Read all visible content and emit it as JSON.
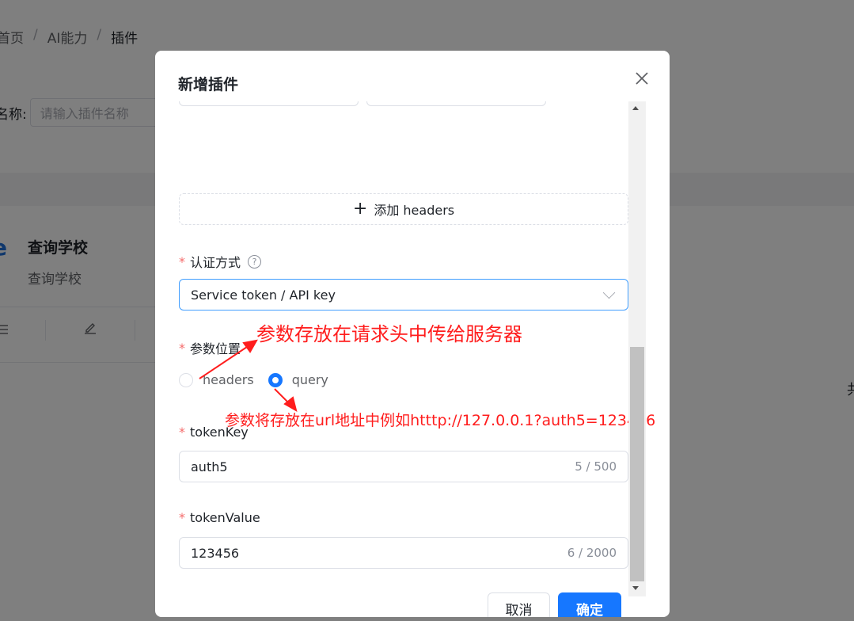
{
  "background": {
    "breadcrumb": [
      "首页",
      "AI能力",
      "插件"
    ],
    "breadcrumb_separator": "/",
    "filter_label": "名称:",
    "filter_placeholder": "请输入插件名称",
    "card_title": "查询学校",
    "card_desc": "查询学校",
    "card_logo": "e",
    "right_edge_text": "共"
  },
  "dialog": {
    "title": "新增插件",
    "add_headers_label": "添加 headers",
    "auth_label": "认证方式",
    "auth_value": "Service token / API key",
    "param_position_label": "参数位置",
    "radio_options": [
      {
        "label": "headers",
        "checked": false
      },
      {
        "label": "query",
        "checked": true
      }
    ],
    "token_key_label": "tokenKey",
    "token_key_value": "auth5",
    "token_key_count": "5 / 500",
    "token_value_label": "tokenValue",
    "token_value_value": "123456",
    "token_value_count": "6 / 2000",
    "cancel_label": "取消",
    "ok_label": "确定",
    "required_mark": "*",
    "help_mark": "?"
  },
  "annotations": {
    "headers_note": "参数存放在请求头中传给服务器",
    "query_note": "参数将存放在url地址中例如htttp://127.0.0.1?auth5=123456",
    "color": "#ff1d1d"
  },
  "colors": {
    "primary": "#1677ff",
    "required": "#f56c6c",
    "select_border": "#409eff"
  },
  "icons": {
    "close": "close-icon",
    "plus": "plus-icon",
    "help": "question-circle-icon",
    "chevron": "chevron-down-icon",
    "list": "list-icon",
    "edit": "edit-icon"
  }
}
